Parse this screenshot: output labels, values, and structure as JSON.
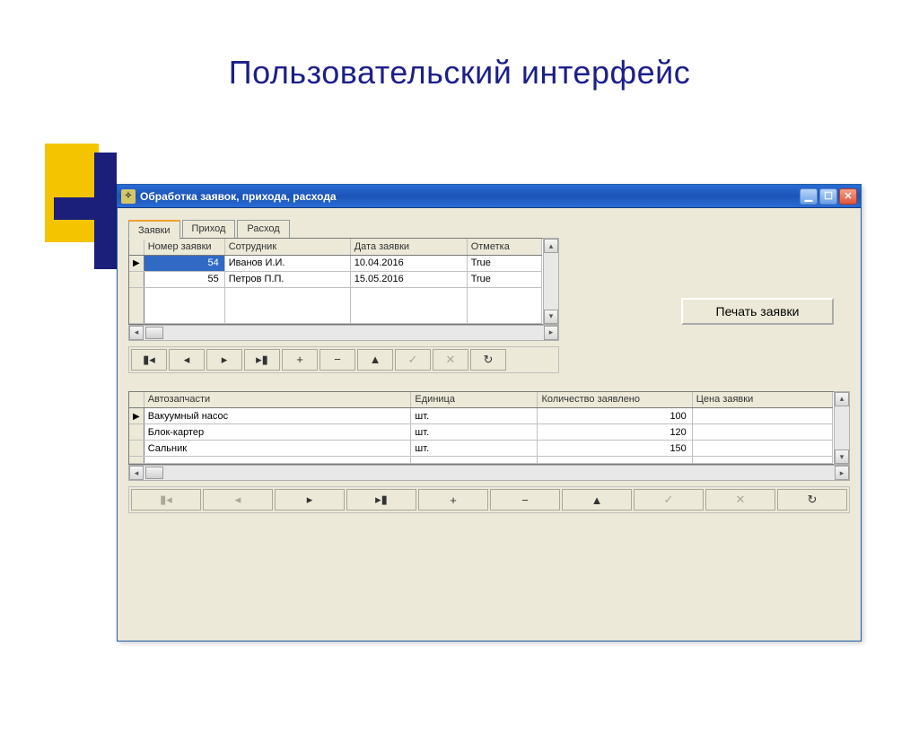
{
  "slide": {
    "title": "Пользовательский интерфейс"
  },
  "window": {
    "title": "Обработка заявок, прихода, расхода"
  },
  "tabs": {
    "items": [
      {
        "label": "Заявки",
        "active": true
      },
      {
        "label": "Приход",
        "active": false
      },
      {
        "label": "Расход",
        "active": false
      }
    ]
  },
  "print_button": {
    "label": "Печать заявки"
  },
  "top_grid": {
    "columns": [
      "Номер заявки",
      "Сотрудник",
      "Дата заявки",
      "Отметка"
    ],
    "rows": [
      {
        "num": "54",
        "employee": "Иванов И.И.",
        "date": "10.04.2016",
        "mark": "True",
        "selected": true
      },
      {
        "num": "55",
        "employee": "Петров П.П.",
        "date": "15.05.2016",
        "mark": "True",
        "selected": false
      }
    ]
  },
  "bottom_grid": {
    "columns": [
      "Автозапчасти",
      "Единица",
      "Количество заявлено",
      "Цена заявки"
    ],
    "rows": [
      {
        "part": "Вакуумный насос",
        "unit": "шт.",
        "qty": "100",
        "price": ""
      },
      {
        "part": "Блок-картер",
        "unit": "шт.",
        "qty": "120",
        "price": ""
      },
      {
        "part": "Сальник",
        "unit": "шт.",
        "qty": "150",
        "price": ""
      }
    ]
  },
  "nav": {
    "first": "⏮",
    "prev": "◄",
    "next": "►",
    "last": "⏭",
    "insert": "+",
    "delete": "−",
    "edit": "▲",
    "post": "✓",
    "cancel": "✕",
    "refresh": "↻"
  }
}
